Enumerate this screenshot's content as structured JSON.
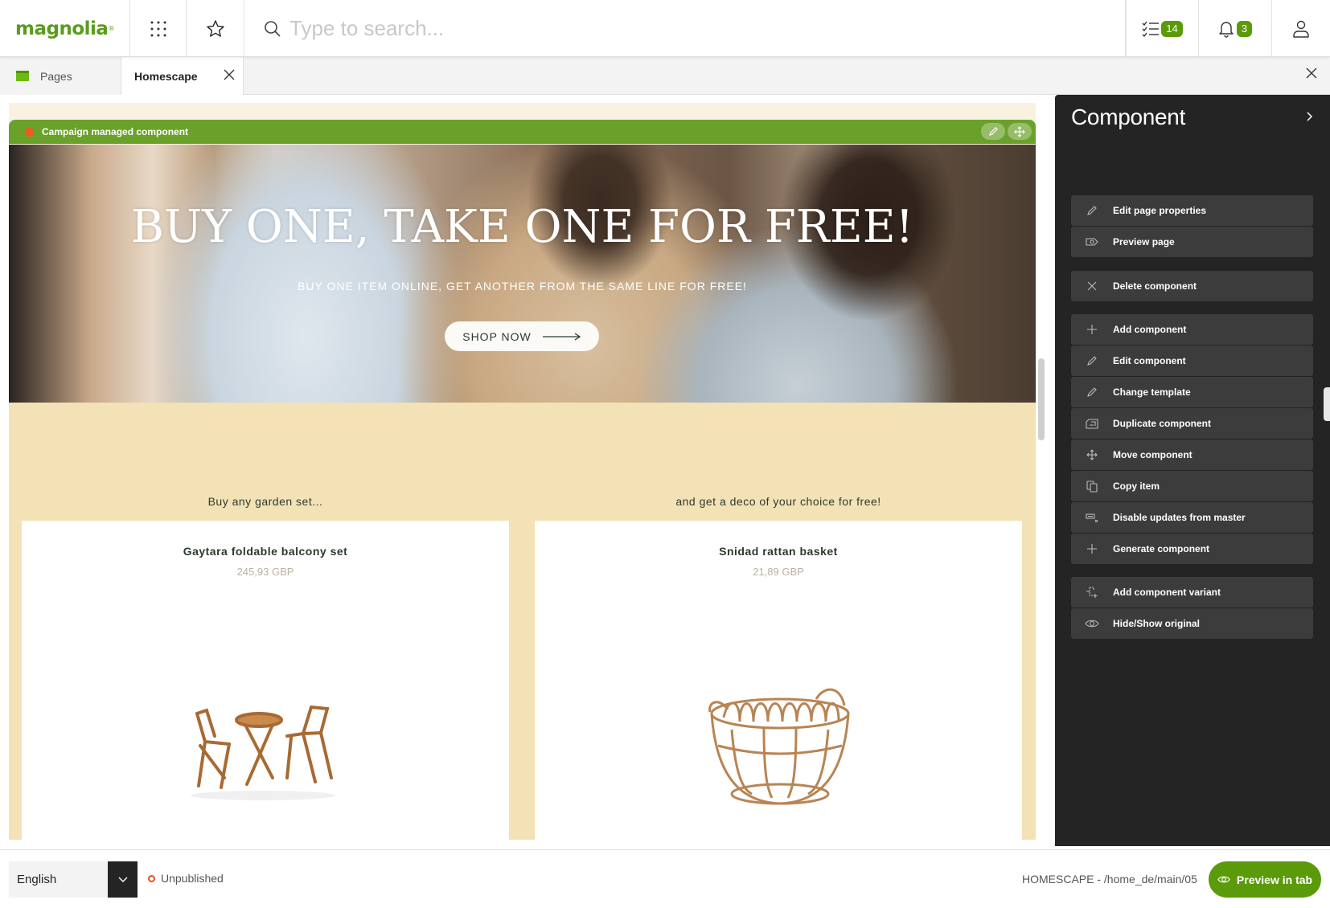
{
  "topbar": {
    "logo": "magnolia",
    "search_placeholder": "Type to search...",
    "tasks_count": "14",
    "notifications_count": "3"
  },
  "tabs": {
    "pages_label": "Pages",
    "active_label": "Homescape"
  },
  "page": {
    "campaign_label": "Campaign managed component",
    "hero": {
      "title": "BUY ONE, TAKE ONE FOR FREE!",
      "subtitle": "BUY ONE ITEM ONLINE, GET ANOTHER FROM THE SAME LINE FOR FREE!",
      "cta": "SHOP NOW"
    },
    "promo": {
      "left_label": "Buy any garden set...",
      "right_label": "and get a deco of your choice for free!",
      "products": [
        {
          "name": "Gaytara foldable balcony set",
          "price": "245,93 GBP"
        },
        {
          "name": "Snidad rattan basket",
          "price": "21,89 GBP"
        }
      ]
    }
  },
  "panel": {
    "title": "Component",
    "actions": [
      {
        "label": "Edit page properties",
        "icon": "pencil-icon"
      },
      {
        "label": "Preview page",
        "icon": "preview-icon"
      },
      {
        "label": "Delete component",
        "icon": "close-icon"
      },
      {
        "label": "Add component",
        "icon": "plus-icon"
      },
      {
        "label": "Edit component",
        "icon": "pencil-icon"
      },
      {
        "label": "Change template",
        "icon": "pencil-icon"
      },
      {
        "label": "Duplicate component",
        "icon": "duplicate-icon"
      },
      {
        "label": "Move component",
        "icon": "move-icon"
      },
      {
        "label": "Copy item",
        "icon": "copy-icon"
      },
      {
        "label": "Disable updates from master",
        "icon": "disable-updates-icon"
      },
      {
        "label": "Generate component",
        "icon": "plus-icon"
      },
      {
        "label": "Add component variant",
        "icon": "add-variant-icon"
      },
      {
        "label": "Hide/Show original",
        "icon": "eye-icon"
      }
    ]
  },
  "footer": {
    "language": "English",
    "status": "Unpublished",
    "path": "HOMESCAPE - /home_de/main/05",
    "preview_label": "Preview in tab"
  },
  "colors": {
    "brand_green": "#5b9a0a",
    "campaign_bar": "#6aa12a",
    "status_unpublished": "#e94e1b",
    "panel_bg": "#242424"
  }
}
